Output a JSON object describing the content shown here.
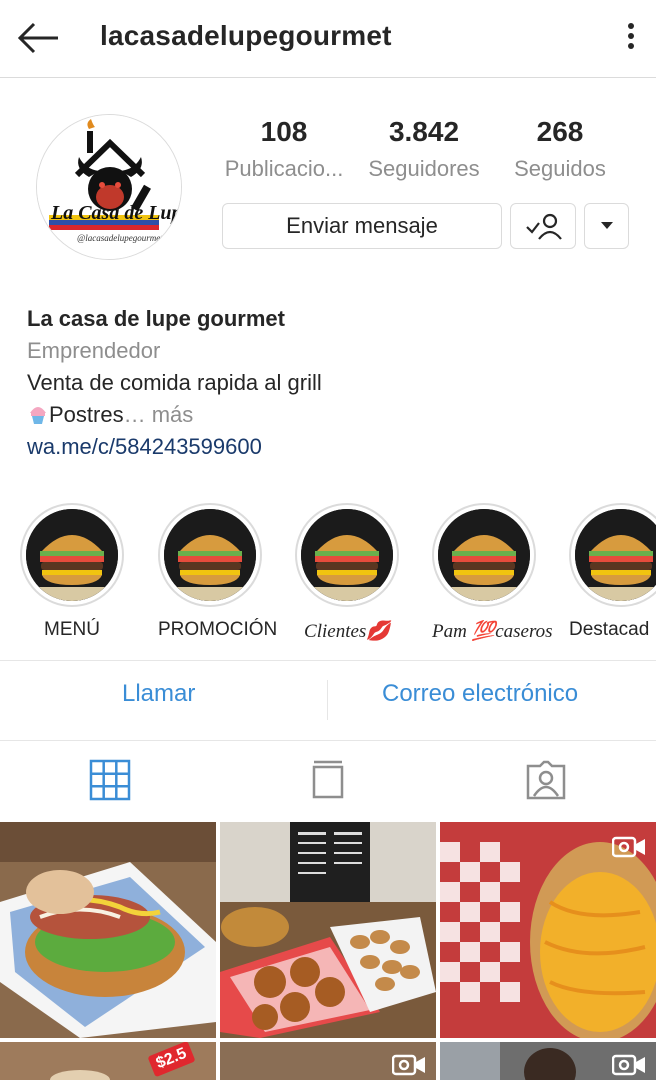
{
  "header": {
    "username": "lacasadelupegourmet",
    "back_icon": "arrow-left-icon",
    "menu_icon": "more-vertical-icon"
  },
  "profile": {
    "avatar_text": "La Casa de Lupe",
    "avatar_subtext": "@lacasadelupegourmet",
    "stats": [
      {
        "value": "108",
        "label": "Publicacio..."
      },
      {
        "value": "3.842",
        "label": "Seguidores"
      },
      {
        "value": "268",
        "label": "Seguidos"
      }
    ],
    "message_button": "Enviar mensaje",
    "name": "La casa de lupe gourmet",
    "category": "Emprendedor",
    "bio_line": "Venta de comida rapida al grill",
    "bio_line2": "Postres",
    "bio_more": "… más",
    "link": "wa.me/c/584243599600"
  },
  "highlights": [
    {
      "label": "MENÚ"
    },
    {
      "label": "PROMOCIÓN"
    },
    {
      "label": "Clientes💋"
    },
    {
      "label": "Pam 💯caseros"
    },
    {
      "label": "Destacad"
    }
  ],
  "contact": {
    "call": "Llamar",
    "email": "Correo electrónico"
  },
  "tabs": [
    "grid-icon",
    "igtv-icon",
    "tagged-icon"
  ],
  "grid": {
    "price_tag": "$2.5"
  },
  "colors": {
    "accent_blue": "#3a8dd6",
    "link": "#1a3a6b",
    "muted": "#8e8e8e"
  }
}
